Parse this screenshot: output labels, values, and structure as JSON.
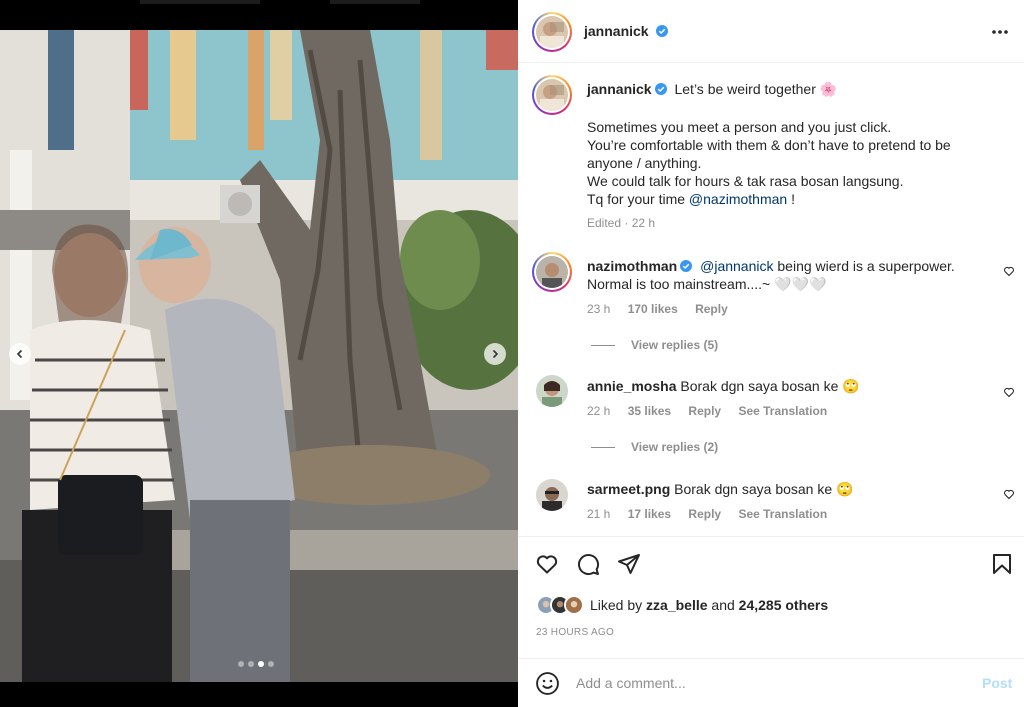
{
  "post": {
    "author": "jannanick",
    "more_icon": "more-horizontal-icon"
  },
  "caption": {
    "author": "jannanick",
    "title_text": "Let’s be weird together 🌸",
    "lines": [
      "Sometimes you meet a person and you just click.",
      "You’re comfortable with them & don’t have to pretend to be",
      "anyone / anything.",
      "We could talk for hours & tak rasa bosan langsung.",
      "Tq for your time "
    ],
    "mention": "@nazimothman",
    "end": " !",
    "meta": "Edited · 22 h"
  },
  "comments": [
    {
      "user": "nazimothman",
      "mention": "@jannanick",
      "text_line1": " being wierd is a superpower.",
      "text_line2": "Normal is too mainstream....~ 🤍🤍🤍",
      "time": "23 h",
      "likes": "170 likes",
      "reply": "Reply",
      "view_replies": "View replies (5)"
    },
    {
      "user": "annie_mosha",
      "text": "Borak dgn saya bosan ke 🙄",
      "time": "22 h",
      "likes": "35 likes",
      "reply": "Reply",
      "translate": "See Translation",
      "view_replies": "View replies (2)"
    },
    {
      "user": "sarmeet.png",
      "text": "Borak dgn saya bosan ke 🙄",
      "time": "21 h",
      "likes": "17 likes",
      "reply": "Reply",
      "translate": "See Translation"
    }
  ],
  "actions": {
    "like_icon": "heart-icon",
    "comment_icon": "comment-bubble-icon",
    "share_icon": "send-paper-plane-icon",
    "save_icon": "bookmark-icon"
  },
  "likes": {
    "prefix": "Liked by ",
    "user": "zza_belle",
    "middle": " and ",
    "others": "24,285 others"
  },
  "timestamp": "23 HOURS AGO",
  "comment_box": {
    "placeholder": "Add a comment...",
    "post_label": "Post",
    "emoji_icon": "emoji-smile-icon"
  },
  "carousel": {
    "slide_count": 4,
    "active_index": 2
  },
  "colors": {
    "verified": "#3897f0",
    "mention": "#00376b",
    "post_disabled": "#b2dffc",
    "muted": "#8e8e8e"
  }
}
